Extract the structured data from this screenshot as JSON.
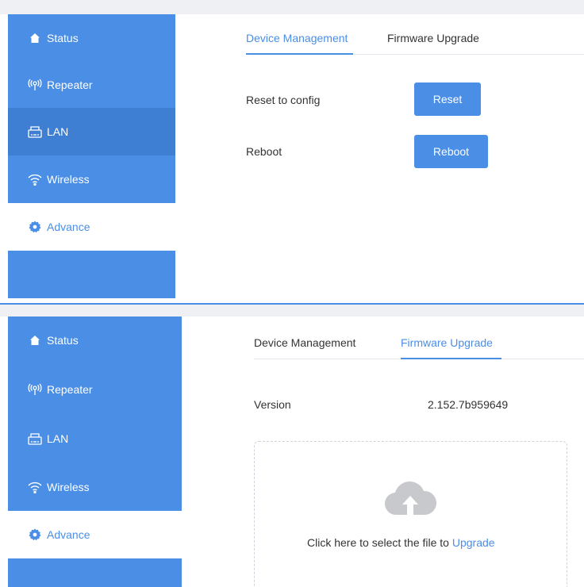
{
  "colors": {
    "accent": "#4a8ee6",
    "sidebar_active": "#3f7fd3"
  },
  "top_panel": {
    "sidebar": [
      {
        "label": "Status",
        "icon": "home-icon"
      },
      {
        "label": "Repeater",
        "icon": "broadcast-icon"
      },
      {
        "label": "LAN",
        "icon": "ethernet-icon"
      },
      {
        "label": "Wireless",
        "icon": "wifi-icon"
      },
      {
        "label": "Advance",
        "icon": "gear-icon"
      }
    ],
    "tabs": [
      "Device Management",
      "Firmware Upgrade"
    ],
    "active_tab": "Device Management",
    "rows": [
      {
        "label": "Reset to config",
        "button": "Reset"
      },
      {
        "label": "Reboot",
        "button": "Reboot"
      }
    ]
  },
  "bottom_panel": {
    "sidebar": [
      {
        "label": "Status",
        "icon": "home-icon"
      },
      {
        "label": "Repeater",
        "icon": "broadcast-icon"
      },
      {
        "label": "LAN",
        "icon": "ethernet-icon"
      },
      {
        "label": "Wireless",
        "icon": "wifi-icon"
      },
      {
        "label": "Advance",
        "icon": "gear-icon"
      }
    ],
    "tabs": [
      "Device Management",
      "Firmware Upgrade"
    ],
    "active_tab": "Firmware Upgrade",
    "version_label": "Version",
    "version_value": "2.152.7b959649",
    "upload_prompt": "Click here to select the file to",
    "upload_link": "Upgrade",
    "upload_icon": "cloud-upload-icon"
  }
}
